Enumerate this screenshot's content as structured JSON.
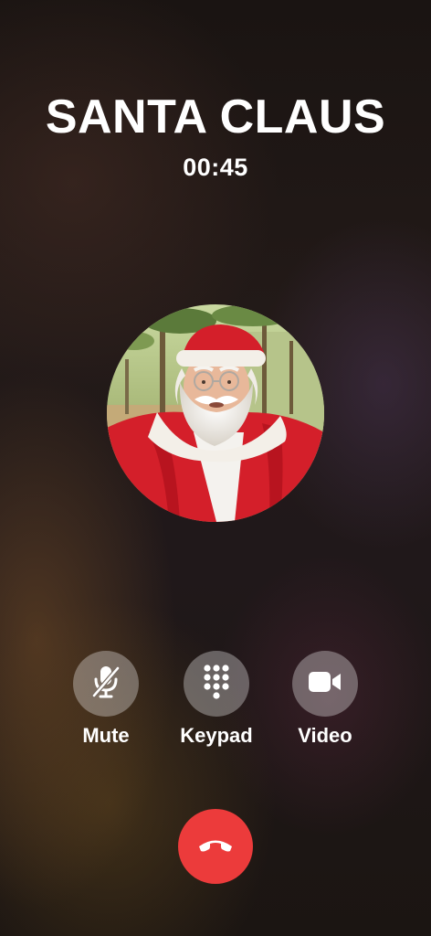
{
  "call": {
    "caller_name": "SANTA CLAUS",
    "duration": "00:45"
  },
  "controls": [
    {
      "label": "Mute",
      "icon": "microphone-slash-icon"
    },
    {
      "label": "Keypad",
      "icon": "keypad-icon"
    },
    {
      "label": "Video",
      "icon": "video-camera-icon"
    }
  ],
  "end_call": {
    "icon": "phone-hangup-icon",
    "color": "#ec3b3b"
  },
  "colors": {
    "button_bg": "rgba(255,255,255,0.32)",
    "text": "#ffffff"
  }
}
